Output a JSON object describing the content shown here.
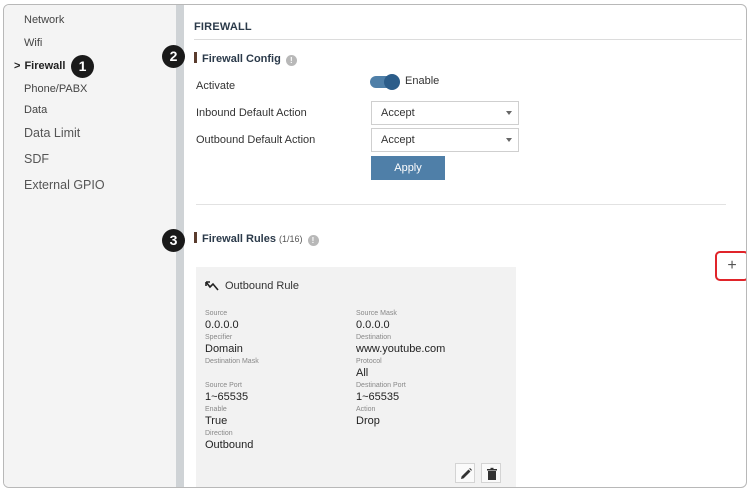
{
  "sidebar": {
    "items": [
      {
        "label": "Network"
      },
      {
        "label": "Wifi"
      },
      {
        "label": "Firewall"
      },
      {
        "label": "Phone/PABX"
      },
      {
        "label": "Data"
      },
      {
        "label": "Data Limit"
      },
      {
        "label": "SDF"
      },
      {
        "label": "External GPIO"
      }
    ],
    "active_chevron": ">"
  },
  "callouts": {
    "one": "1",
    "two": "2",
    "three": "3"
  },
  "page": {
    "title": "FIREWALL"
  },
  "config": {
    "title": "Firewall Config",
    "activate_label": "Activate",
    "toggle_label": "Enable",
    "toggle_on": true,
    "inbound_label": "Inbound Default Action",
    "inbound_value": "Accept",
    "outbound_label": "Outbound Default Action",
    "outbound_value": "Accept",
    "apply_label": "Apply"
  },
  "rules": {
    "title": "Firewall Rules",
    "count": "(1/16)",
    "add_label": "+",
    "card": {
      "title": "Outbound Rule",
      "fields": {
        "source_label": "Source",
        "source_value": "0.0.0.0",
        "source_mask_label": "Source Mask",
        "source_mask_value": "0.0.0.0",
        "specifier_label": "Specifier",
        "specifier_value": "Domain",
        "destination_label": "Destination",
        "destination_value": "www.youtube.com",
        "destination_mask_label": "Destination Mask",
        "protocol_label": "Protocol",
        "protocol_value": "All",
        "source_port_label": "Source Port",
        "source_port_value": "1~65535",
        "destination_port_label": "Destination Port",
        "destination_port_value": "1~65535",
        "enable_label": "Enable",
        "enable_value": "True",
        "action_label": "Action",
        "action_value": "Drop",
        "direction_label": "Direction",
        "direction_value": "Outbound"
      }
    }
  },
  "colors": {
    "accent": "#4f7fa8",
    "highlight": "#e0242a",
    "sidebar": "#f4f4f4",
    "card": "#f2f2f2"
  },
  "icons": {
    "info": "info-icon",
    "rule": "outbound-rule-icon",
    "edit": "pencil-icon",
    "delete": "trash-icon",
    "dropdown": "caret-down-icon"
  }
}
